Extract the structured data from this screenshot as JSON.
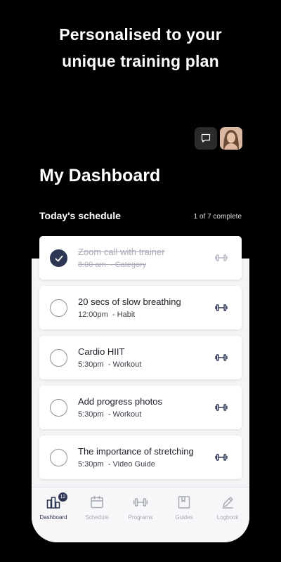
{
  "promo": {
    "line1": "Personalised to your",
    "line2": "unique training plan"
  },
  "dashboard": {
    "title": "My Dashboard"
  },
  "schedule": {
    "title": "Today's schedule",
    "progress_text": "1 of 7 complete",
    "items": [
      {
        "title": "Zoom call with trainer",
        "time": "8:00 am",
        "category": "- Category",
        "completed": true
      },
      {
        "title": "20 secs of slow breathing",
        "time": "12:00pm",
        "category": "- Habit",
        "completed": false
      },
      {
        "title": "Cardio HIIT",
        "time": "5:30pm",
        "category": "- Workout",
        "completed": false
      },
      {
        "title": "Add progress photos",
        "time": "5:30pm",
        "category": "- Workout",
        "completed": false
      },
      {
        "title": "The importance of stretching",
        "time": "5:30pm",
        "category": "- Video Guide",
        "completed": false
      }
    ]
  },
  "tabs": [
    {
      "label": "Dashboard",
      "icon": "bar-chart-icon",
      "active": true,
      "badge": "12"
    },
    {
      "label": "Schedule",
      "icon": "calendar-icon",
      "active": false
    },
    {
      "label": "Programs",
      "icon": "dumbbell-icon",
      "active": false
    },
    {
      "label": "Guides",
      "icon": "book-icon",
      "active": false
    },
    {
      "label": "Logbook",
      "icon": "pencil-icon",
      "active": false
    }
  ],
  "colors": {
    "accent": "#2d3653",
    "muted": "#a4a9b4",
    "card_bg": "#ffffff",
    "background": "#000000"
  }
}
